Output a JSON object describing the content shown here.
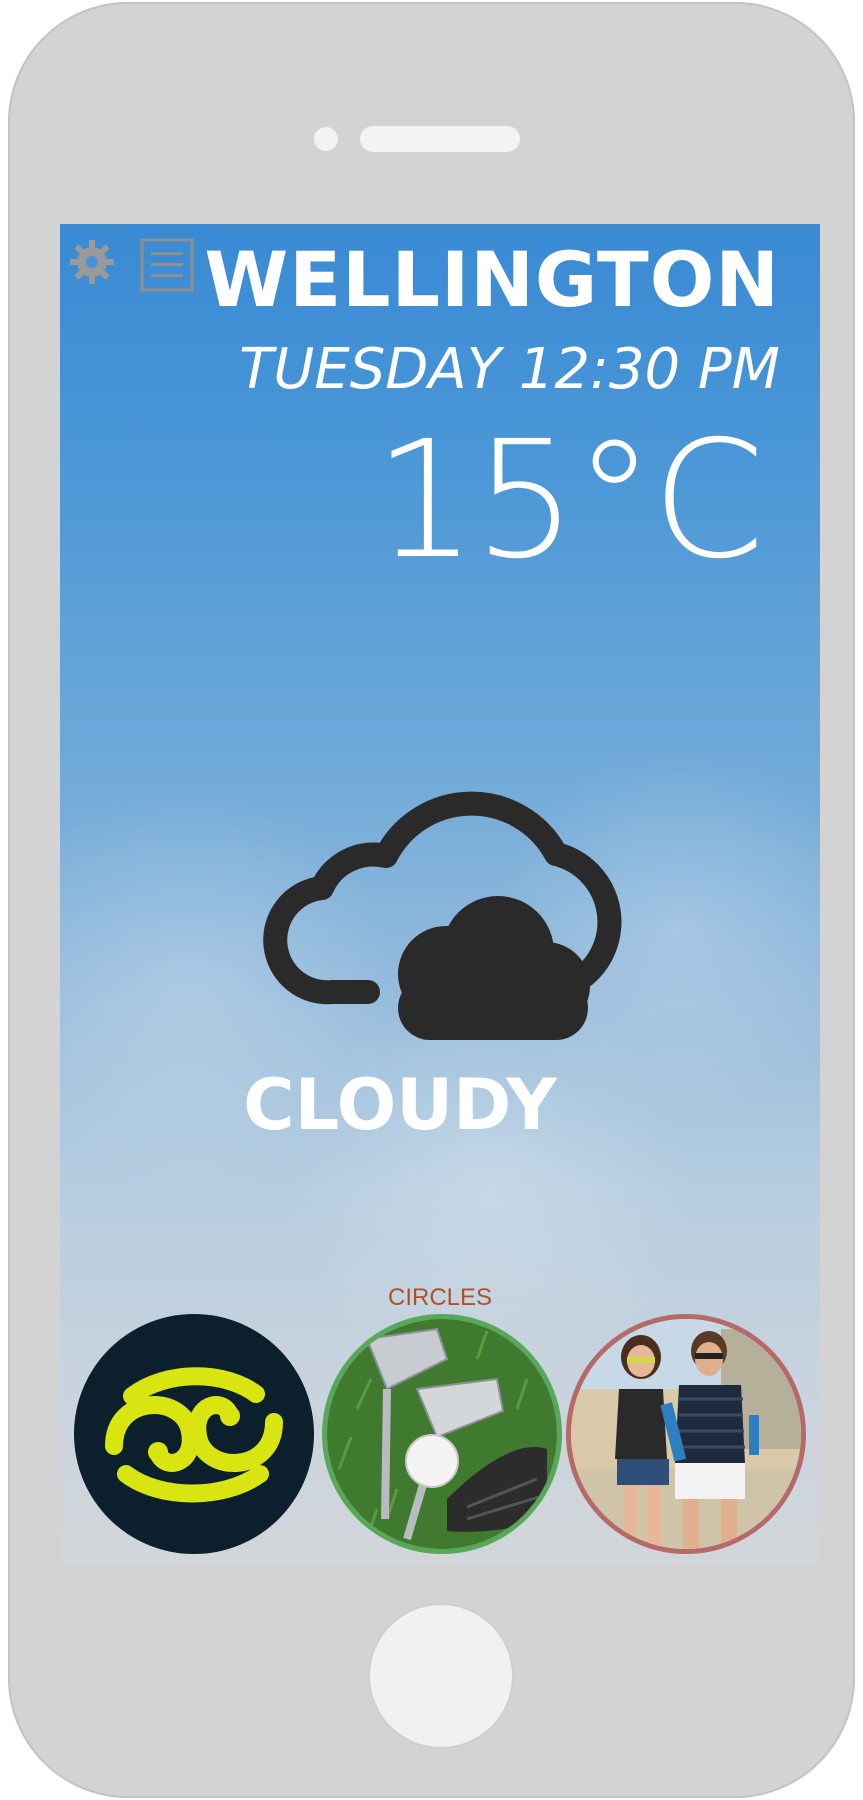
{
  "header": {
    "settings_icon": "gear-icon",
    "menu_icon": "list-menu-icon"
  },
  "weather": {
    "city": "WELLINGTON",
    "datetime": "TUESDAY 12:30 PM",
    "temperature": "15°C",
    "condition": "CLOUDY",
    "condition_icon": "cloud-icon"
  },
  "circles": {
    "label": "CIRCLES",
    "items": [
      {
        "icon": "koru-logo",
        "background": "#0c1f2c",
        "accent": "#d8e510"
      },
      {
        "icon": "golf-photo",
        "border": "#58a85a"
      },
      {
        "icon": "friends-photo",
        "border": "#b56a6a"
      }
    ]
  },
  "colors": {
    "screen_top": "#3a8ad4",
    "screen_bottom": "#d2d6da",
    "text": "#ffffff",
    "circles_label": "#b0502a",
    "cloud": "#2a2a2a"
  }
}
